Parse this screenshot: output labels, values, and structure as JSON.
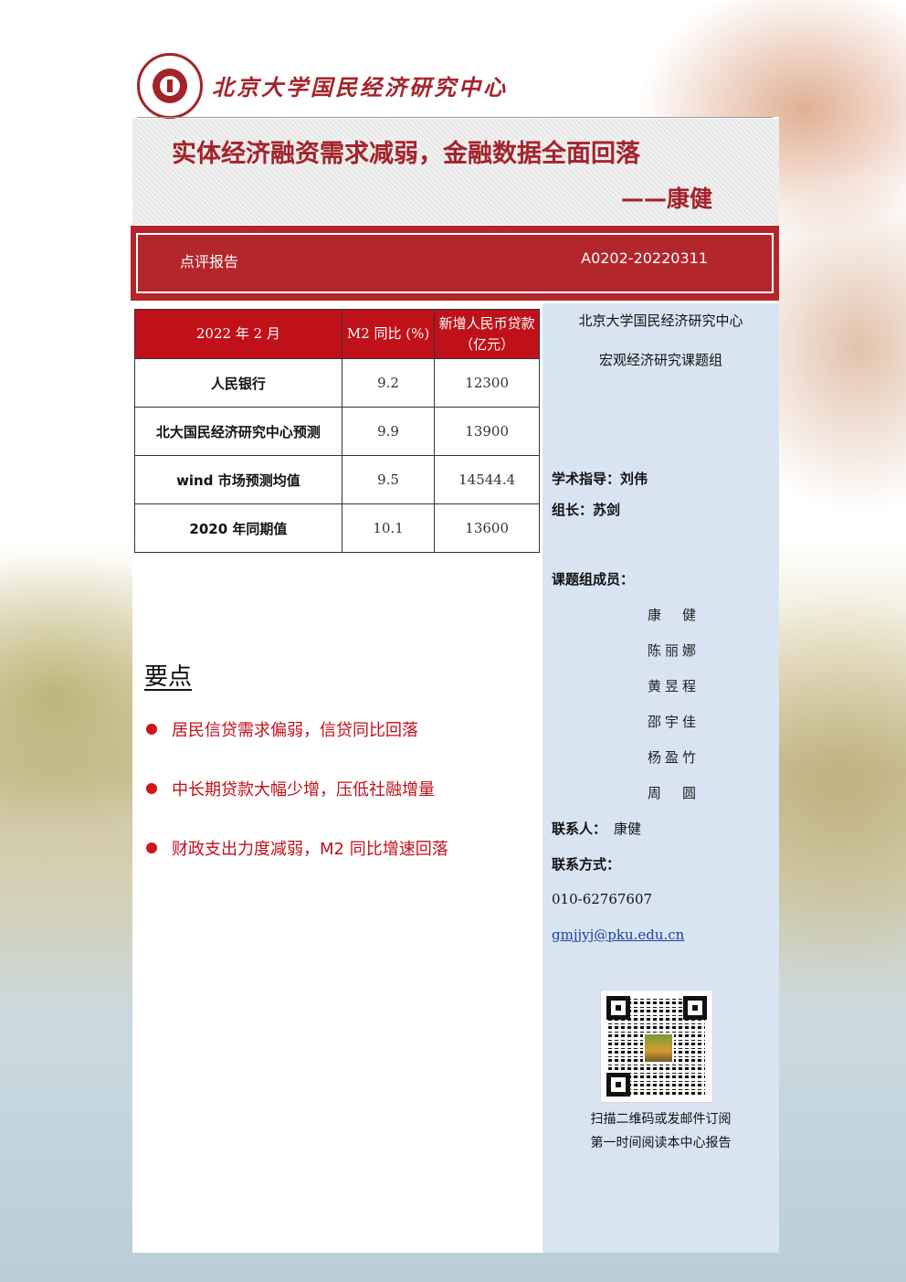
{
  "header": {
    "org_name": "北京大学国民经济研究中心",
    "logo": "peking-university-seal-icon"
  },
  "title": {
    "main": "实体经济融资需求减弱，金融数据全面回落",
    "author": "——康健"
  },
  "banner": {
    "report_type": "点评报告",
    "report_code": "A0202-20220311"
  },
  "table": {
    "headers": [
      "2022 年 2 月",
      "M2 同比 (%)",
      "新增人民币贷款（亿元）"
    ],
    "rows": [
      {
        "label": "人民银行",
        "m2": "9.2",
        "loan": "12300"
      },
      {
        "label": "北大国民经济研究中心预测",
        "m2": "9.9",
        "loan": "13900"
      },
      {
        "label": "wind 市场预测均值",
        "m2": "9.5",
        "loan": "14544.4"
      },
      {
        "label": "2020 年同期值",
        "m2": "10.1",
        "loan": "13600"
      }
    ]
  },
  "keypoints": {
    "title": "要点",
    "items": [
      "居民信贷需求偏弱，信贷同比回落",
      "中长期贷款大幅少增，压低社融增量",
      "财政支出力度减弱，M2 同比增速回落"
    ]
  },
  "sidebar": {
    "org": "北京大学国民经济研究中心",
    "group": "宏观经济研究课题组",
    "advisor": "学术指导：刘伟",
    "leader": "组长：苏剑",
    "members_label": "课题组成员：",
    "members": [
      "康　健",
      "陈丽娜",
      "黄昱程",
      "邵宇佳",
      "杨盈竹",
      "周　圆"
    ],
    "contact_label": "联系人：",
    "contact_name": "康健",
    "contact_method_label": "联系方式：",
    "phone": "010-62767607",
    "email": "gmjjyj@pku.edu.cn",
    "qr_icon": "qr-code-icon",
    "subscribe_line1": "扫描二维码或发邮件订阅",
    "subscribe_line2": "第一时间阅读本中心报告"
  },
  "colors": {
    "brand_red": "#a4232a",
    "banner_red": "#b3262b",
    "table_header_red": "#c0111a",
    "sidebar_blue": "#d9e4f2"
  }
}
